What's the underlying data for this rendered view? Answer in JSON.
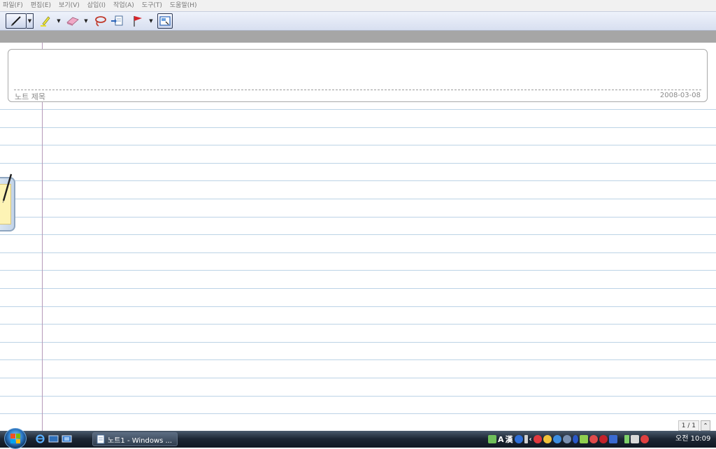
{
  "menu": [
    {
      "label": "파일(F)"
    },
    {
      "label": "편집(E)"
    },
    {
      "label": "보기(V)"
    },
    {
      "label": "삽입(I)"
    },
    {
      "label": "작업(A)"
    },
    {
      "label": "도구(T)"
    },
    {
      "label": "도움말(H)"
    }
  ],
  "toolbar": {
    "icons": [
      "pen-icon",
      "highlighter-icon",
      "eraser-icon",
      "lasso-icon",
      "insert-space-icon",
      "flag-icon",
      "selection-mode-icon"
    ]
  },
  "note": {
    "title_placeholder": "노트 제목",
    "date": "2008-03-08"
  },
  "pager": {
    "page_indicator": "1 / 1"
  },
  "taskbar": {
    "window_button": "노트1 - Windows ...",
    "ime_a": "A",
    "ime_han": "漢",
    "clock": "오전 10:09"
  },
  "colors": {
    "ruled_line": "#bcd3e6",
    "margin_line": "#b59ab8",
    "taskbar": "#1c2633",
    "accent": "#2b78c5"
  }
}
